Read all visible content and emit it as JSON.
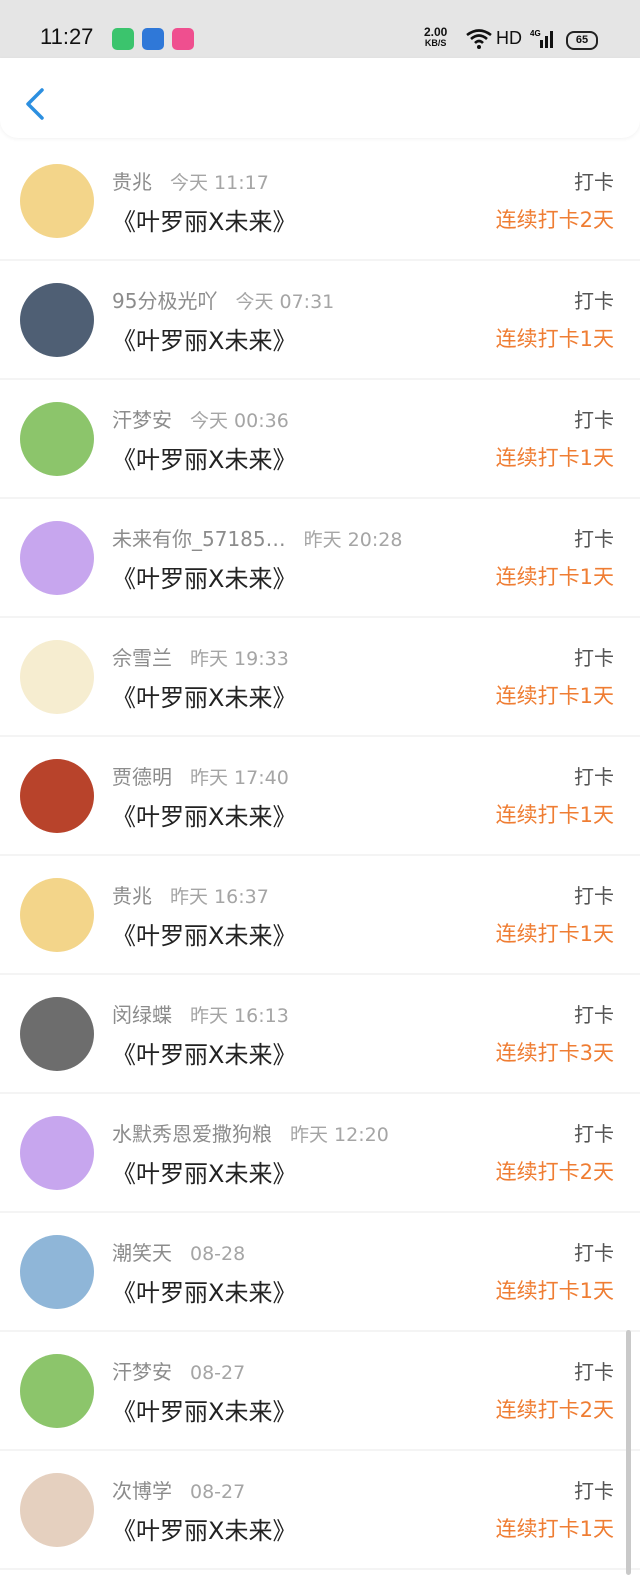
{
  "status": {
    "time": "11:27",
    "speed_value": "2.00",
    "speed_unit": "KB/S",
    "network": "HD",
    "cell": "4G",
    "battery": "65"
  },
  "header": {
    "back_icon": "chevron-left-icon"
  },
  "checkins": [
    {
      "user": "贵兆",
      "time": "今天 11:17",
      "title": "《叶罗丽X未来》",
      "label": "打卡",
      "streak": "连续打卡2天",
      "avatar_color": "#f3d58a"
    },
    {
      "user": "95分极光吖",
      "time": "今天 07:31",
      "title": "《叶罗丽X未来》",
      "label": "打卡",
      "streak": "连续打卡1天",
      "avatar_color": "#4f5f74"
    },
    {
      "user": "汗梦安",
      "time": "今天 00:36",
      "title": "《叶罗丽X未来》",
      "label": "打卡",
      "streak": "连续打卡1天",
      "avatar_color": "#8cc56b"
    },
    {
      "user": "未来有你_57185…",
      "time": "昨天 20:28",
      "title": "《叶罗丽X未来》",
      "label": "打卡",
      "streak": "连续打卡1天",
      "avatar_color": "#c7a6ee"
    },
    {
      "user": "佘雪兰",
      "time": "昨天 19:33",
      "title": "《叶罗丽X未来》",
      "label": "打卡",
      "streak": "连续打卡1天",
      "avatar_color": "#f6edd0"
    },
    {
      "user": "贾德明",
      "time": "昨天 17:40",
      "title": "《叶罗丽X未来》",
      "label": "打卡",
      "streak": "连续打卡1天",
      "avatar_color": "#b8432b"
    },
    {
      "user": "贵兆",
      "time": "昨天 16:37",
      "title": "《叶罗丽X未来》",
      "label": "打卡",
      "streak": "连续打卡1天",
      "avatar_color": "#f3d58a"
    },
    {
      "user": "闵绿蝶",
      "time": "昨天 16:13",
      "title": "《叶罗丽X未来》",
      "label": "打卡",
      "streak": "连续打卡3天",
      "avatar_color": "#6d6d6d"
    },
    {
      "user": "水默秀恩爱撒狗粮",
      "time": "昨天 12:20",
      "title": "《叶罗丽X未来》",
      "label": "打卡",
      "streak": "连续打卡2天",
      "avatar_color": "#c7a6ee"
    },
    {
      "user": "潮笑天",
      "time": "08-28",
      "title": "《叶罗丽X未来》",
      "label": "打卡",
      "streak": "连续打卡1天",
      "avatar_color": "#8fb6d8"
    },
    {
      "user": "汗梦安",
      "time": "08-27",
      "title": "《叶罗丽X未来》",
      "label": "打卡",
      "streak": "连续打卡2天",
      "avatar_color": "#8cc56b"
    },
    {
      "user": "次博学",
      "time": "08-27",
      "title": "《叶罗丽X未来》",
      "label": "打卡",
      "streak": "连续打卡1天",
      "avatar_color": "#e5d0bf"
    }
  ]
}
